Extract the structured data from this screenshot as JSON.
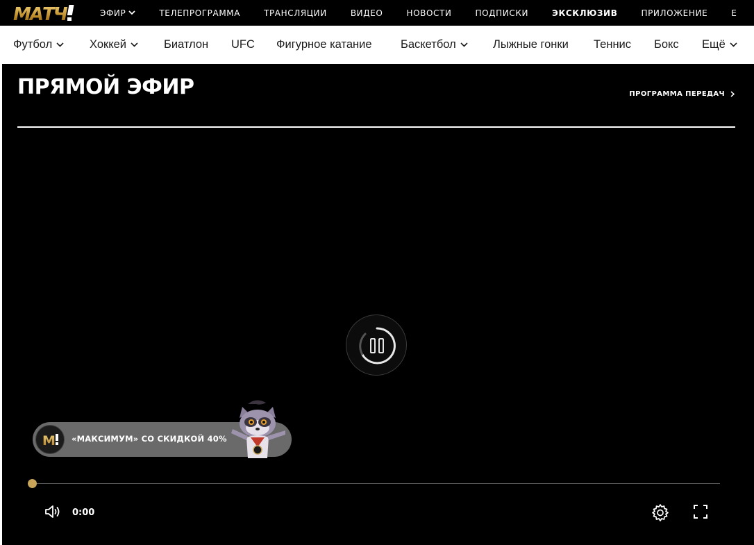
{
  "brand": {
    "logo_text": "МАТЧ!",
    "accent": "#c9a55a"
  },
  "topnav": {
    "items": [
      {
        "label": "ЭФИР",
        "has_dropdown": true
      },
      {
        "label": "ТЕЛЕПРОГРАММА"
      },
      {
        "label": "ТРАНСЛЯЦИИ"
      },
      {
        "label": "ВИДЕО"
      },
      {
        "label": "НОВОСТИ"
      },
      {
        "label": "ПОДПИСКИ"
      },
      {
        "label": "ЭКСКЛЮЗИВ",
        "bold": true
      },
      {
        "label": "ПРИЛОЖЕНИЕ"
      },
      {
        "label": "Е"
      }
    ]
  },
  "sportsbar": {
    "items": [
      {
        "label": "Футбол",
        "has_dropdown": true
      },
      {
        "label": "Хоккей",
        "has_dropdown": true
      },
      {
        "label": "Биатлон"
      },
      {
        "label": "UFC"
      },
      {
        "label": "Фигурное катание"
      },
      {
        "label": "Баскетбол",
        "has_dropdown": true
      },
      {
        "label": "Лыжные гонки"
      },
      {
        "label": "Теннис"
      },
      {
        "label": "Бокс"
      },
      {
        "label": "Ещё",
        "has_dropdown": true
      }
    ]
  },
  "player": {
    "title": "ПРЯМОЙ ЭФИР",
    "program_link": "ПРОГРАММА ПЕРЕДАЧ",
    "promo_text": "«МАКСИМУМ» СО СКИДКОЙ 40%",
    "time": "0:00",
    "progress": 0.0,
    "center_icon": "pause-loading-icon",
    "controls": [
      "volume-icon",
      "settings-icon",
      "fullscreen-icon"
    ]
  }
}
